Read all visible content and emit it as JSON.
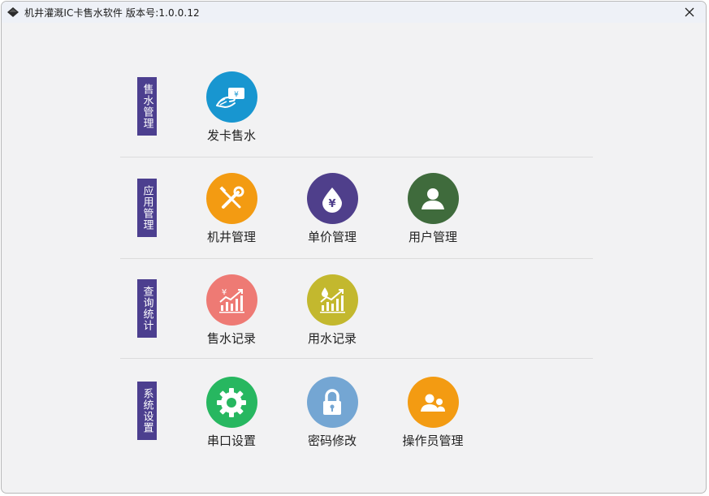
{
  "window": {
    "title": "机井灌溉IC卡售水软件  版本号:1.0.0.12"
  },
  "sections": [
    {
      "label": "售水管理",
      "items": [
        {
          "label": "发卡售水",
          "icon": "card-sell-icon",
          "color": "#1896d0"
        }
      ]
    },
    {
      "label": "应用管理",
      "items": [
        {
          "label": "机井管理",
          "icon": "tools-icon",
          "color": "#f39b12"
        },
        {
          "label": "单价管理",
          "icon": "water-price-icon",
          "color": "#4f3f8b"
        },
        {
          "label": "用户管理",
          "icon": "user-icon",
          "color": "#3f6b3c"
        }
      ]
    },
    {
      "label": "查询统计",
      "items": [
        {
          "label": "售水记录",
          "icon": "sales-chart-icon",
          "color": "#ee7a74"
        },
        {
          "label": "用水记录",
          "icon": "water-chart-icon",
          "color": "#c3b82e"
        }
      ]
    },
    {
      "label": "系统设置",
      "items": [
        {
          "label": "串口设置",
          "icon": "gear-icon",
          "color": "#27b760"
        },
        {
          "label": "密码修改",
          "icon": "lock-icon",
          "color": "#74a6d3"
        },
        {
          "label": "操作员管理",
          "icon": "operators-icon",
          "color": "#f39b12"
        }
      ]
    }
  ]
}
